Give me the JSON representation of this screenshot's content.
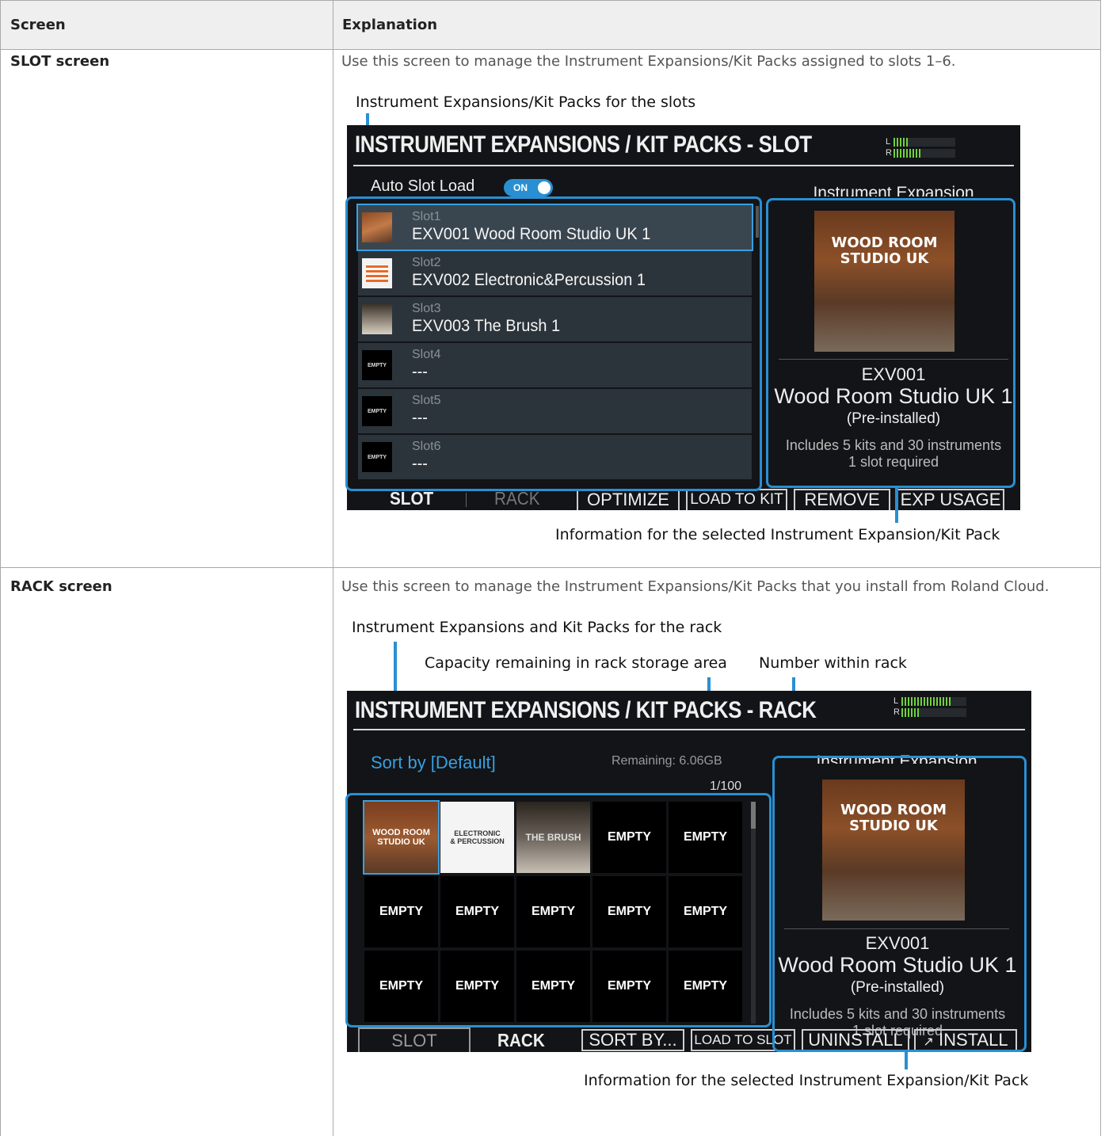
{
  "table": {
    "col_screen": "Screen",
    "col_explanation": "Explanation",
    "rows": [
      {
        "screen": "SLOT screen",
        "description": "Use this screen to manage the Instrument Expansions/Kit Packs assigned to slots 1–6.",
        "callout_top": "Instrument Expansions/Kit Packs for the slots",
        "callout_bottom": "Information for the selected Instrument Expansion/Kit Pack"
      },
      {
        "screen": "RACK screen",
        "description": "Use this screen to manage the Instrument Expansions/Kit Packs that you install from Roland Cloud.",
        "callout_top": "Instrument Expansions and Kit Packs for the rack",
        "callout_capacity": "Capacity remaining in rack storage area",
        "callout_number": "Number within rack",
        "callout_bottom": "Information for the selected Instrument Expansion/Kit Pack"
      }
    ]
  },
  "slot_screen": {
    "title": "INSTRUMENT EXPANSIONS / KIT PACKS - SLOT",
    "meter_l": "L",
    "meter_r": "R",
    "auto_slot_load": "Auto Slot Load",
    "toggle": "ON",
    "panel_heading": "Instrument Expansion",
    "slots": [
      {
        "label": "Slot1",
        "name": "EXV001  Wood Room Studio UK 1"
      },
      {
        "label": "Slot2",
        "name": "EXV002 Electronic&Percussion 1"
      },
      {
        "label": "Slot3",
        "name": "EXV003 The Brush 1"
      },
      {
        "label": "Slot4",
        "name": "---",
        "thumb": "EMPTY"
      },
      {
        "label": "Slot5",
        "name": "---",
        "thumb": "EMPTY"
      },
      {
        "label": "Slot6",
        "name": "---",
        "thumb": "EMPTY"
      }
    ],
    "art_title": "WOOD ROOM",
    "art_sub": "STUDIO UK",
    "info": {
      "code": "EXV001",
      "name": "Wood Room Studio UK 1",
      "status": "(Pre-installed)",
      "includes": "Includes 5 kits and 30 instruments",
      "slots": "1 slot required"
    },
    "tabs": {
      "slot": "SLOT",
      "rack": "RACK"
    },
    "buttons": [
      "OPTIMIZE",
      "LOAD TO KIT",
      "REMOVE",
      "EXP USAGE"
    ]
  },
  "rack_screen": {
    "title": "INSTRUMENT EXPANSIONS / KIT PACKS - RACK",
    "meter_l": "L",
    "meter_r": "R",
    "sort": "Sort by [Default]",
    "remaining": "Remaining: 6.06GB",
    "count": "1/100",
    "panel_heading": "Instrument Expansion",
    "empty": "EMPTY",
    "art_title": "WOOD ROOM",
    "art_sub": "STUDIO UK",
    "art2_title": "ELECTRONIC",
    "art2_sub": "& PERCUSSION",
    "art3_title": "THE BRUSH",
    "info": {
      "code": "EXV001",
      "name": "Wood Room Studio UK 1",
      "status": "(Pre-installed)",
      "includes": "Includes 5 kits and 30 instruments",
      "slots": "1 slot required"
    },
    "tabs": {
      "slot": "SLOT",
      "rack": "RACK"
    },
    "buttons": [
      "SORT BY...",
      "LOAD TO SLOT",
      "UNINSTALL",
      "INSTALL"
    ]
  }
}
